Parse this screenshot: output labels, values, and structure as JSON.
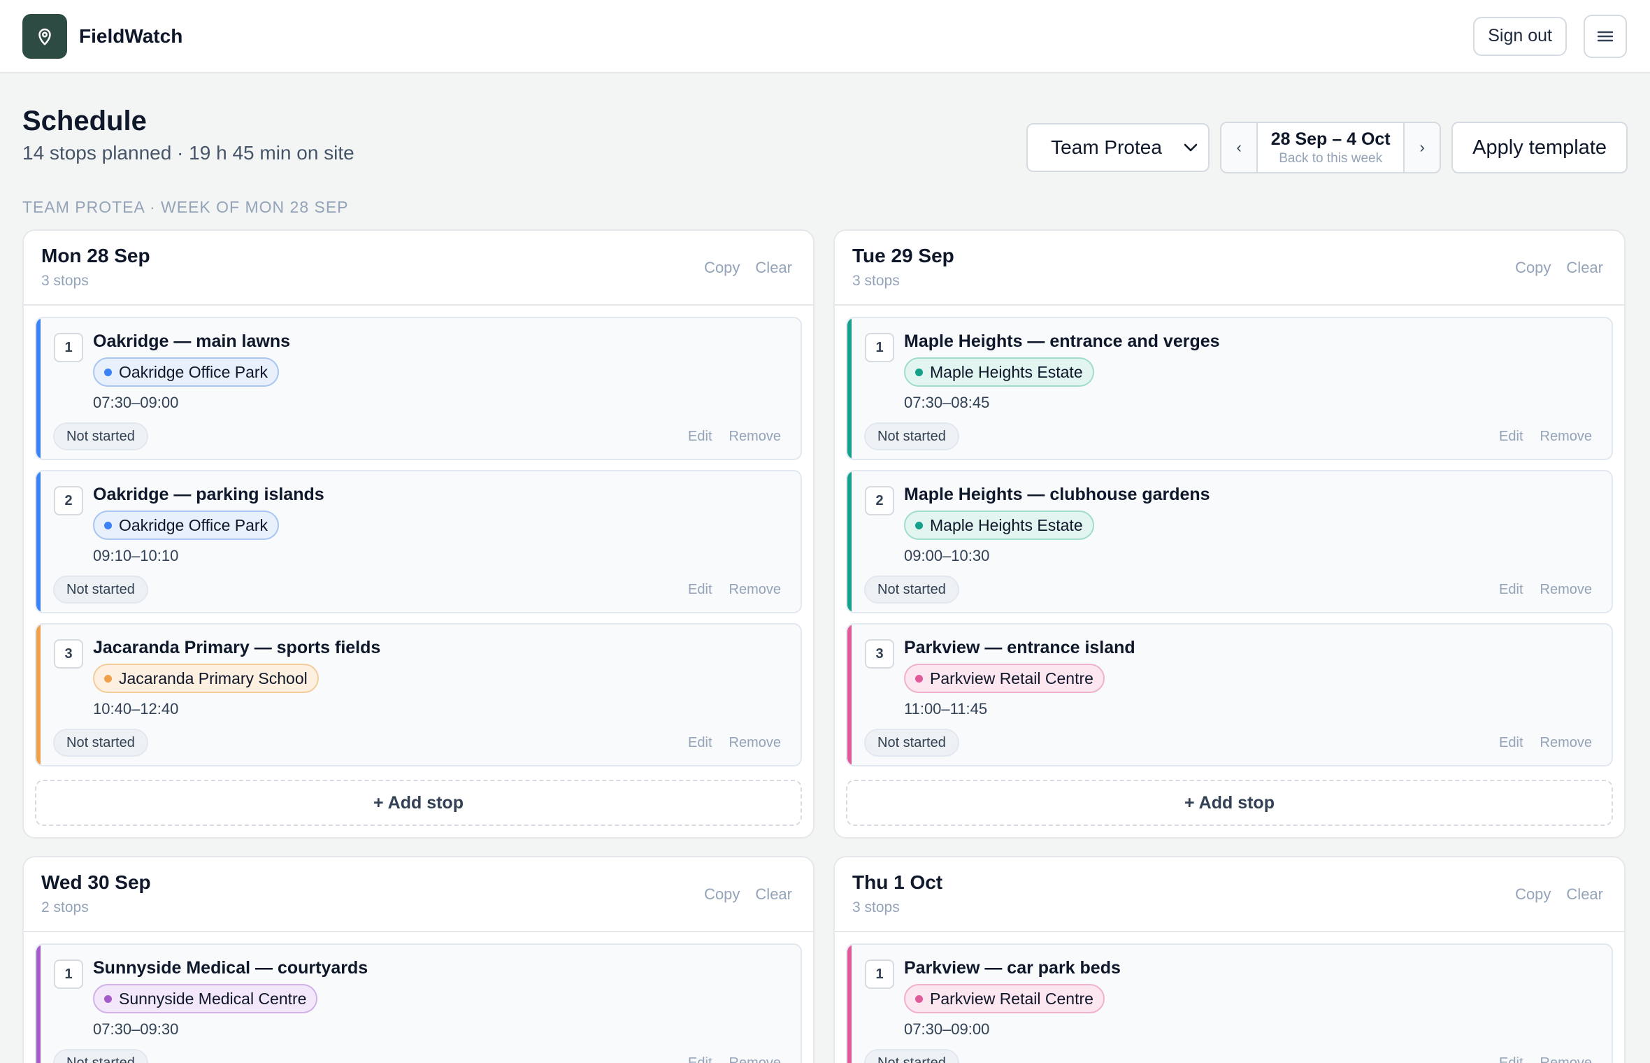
{
  "app": {
    "name": "FieldWatch"
  },
  "header": {
    "sign_out": "Sign out"
  },
  "page": {
    "title": "Schedule",
    "subtitle": "14 stops planned · 19 h 45 min on site",
    "team_select": "Team Protea",
    "week_range": "28 Sep – 4 Oct",
    "week_back": "Back to this week",
    "prev": "‹",
    "next": "›",
    "apply_template": "Apply template",
    "section_label": "TEAM PROTEA · WEEK OF MON 28 SEP"
  },
  "labels": {
    "copy": "Copy",
    "clear": "Clear",
    "edit": "Edit",
    "remove": "Remove",
    "add_stop": "+ Add stop"
  },
  "colors": {
    "blue": "#3b82f6",
    "teal": "#14a08a",
    "orange": "#f0a04b",
    "pink": "#e05a9a",
    "purple": "#a55cc9",
    "brand": "#2d4a43"
  },
  "days": [
    {
      "title": "Mon 28 Sep",
      "count": "3 stops",
      "stops": [
        {
          "num": "1",
          "title": "Oakridge — main lawns",
          "site": "Oakridge Office Park",
          "color": "blue",
          "time": "07:30–09:00",
          "status": "Not started"
        },
        {
          "num": "2",
          "title": "Oakridge — parking islands",
          "site": "Oakridge Office Park",
          "color": "blue",
          "time": "09:10–10:10",
          "status": "Not started"
        },
        {
          "num": "3",
          "title": "Jacaranda Primary — sports fields",
          "site": "Jacaranda Primary School",
          "color": "orange",
          "time": "10:40–12:40",
          "status": "Not started"
        }
      ]
    },
    {
      "title": "Tue 29 Sep",
      "count": "3 stops",
      "stops": [
        {
          "num": "1",
          "title": "Maple Heights — entrance and verges",
          "site": "Maple Heights Estate",
          "color": "teal",
          "time": "07:30–08:45",
          "status": "Not started"
        },
        {
          "num": "2",
          "title": "Maple Heights — clubhouse gardens",
          "site": "Maple Heights Estate",
          "color": "teal",
          "time": "09:00–10:30",
          "status": "Not started"
        },
        {
          "num": "3",
          "title": "Parkview — entrance island",
          "site": "Parkview Retail Centre",
          "color": "pink",
          "time": "11:00–11:45",
          "status": "Not started"
        }
      ]
    },
    {
      "title": "Wed 30 Sep",
      "count": "2 stops",
      "stops": [
        {
          "num": "1",
          "title": "Sunnyside Medical — courtyards",
          "site": "Sunnyside Medical Centre",
          "color": "purple",
          "time": "07:30–09:30",
          "status": "Not started"
        }
      ]
    },
    {
      "title": "Thu 1 Oct",
      "count": "3 stops",
      "stops": [
        {
          "num": "1",
          "title": "Parkview — car park beds",
          "site": "Parkview Retail Centre",
          "color": "pink",
          "time": "07:30–09:00",
          "status": "Not started"
        }
      ]
    }
  ]
}
